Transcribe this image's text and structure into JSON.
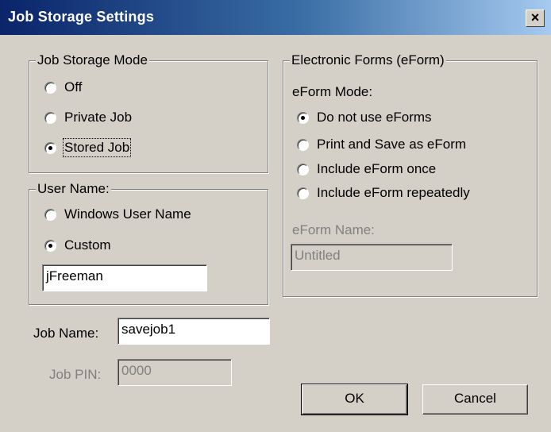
{
  "window": {
    "title": "Job Storage Settings",
    "close_symbol": "×"
  },
  "job_storage_mode": {
    "legend": "Job Storage Mode",
    "options": [
      {
        "label": "Off",
        "checked": false
      },
      {
        "label": "Private Job",
        "checked": false
      },
      {
        "label": "Stored Job",
        "checked": true
      }
    ]
  },
  "user_name": {
    "legend": "User Name:",
    "options": [
      {
        "label": "Windows User Name",
        "checked": false
      },
      {
        "label": "Custom",
        "checked": true
      }
    ],
    "custom_value": "jFreeman"
  },
  "job_name": {
    "label": "Job Name:",
    "value": "savejob1"
  },
  "job_pin": {
    "label": "Job PIN:",
    "value": "0000"
  },
  "eforms": {
    "legend": "Electronic Forms (eForm)",
    "mode_label": "eForm Mode:",
    "options": [
      {
        "label": "Do not use eForms",
        "checked": true
      },
      {
        "label": "Print and Save as eForm",
        "checked": false
      },
      {
        "label": "Include eForm once",
        "checked": false
      },
      {
        "label": "Include eForm repeatedly",
        "checked": false
      }
    ],
    "name_label": "eForm Name:",
    "name_value": "Untitled"
  },
  "buttons": {
    "ok": "OK",
    "cancel": "Cancel"
  }
}
